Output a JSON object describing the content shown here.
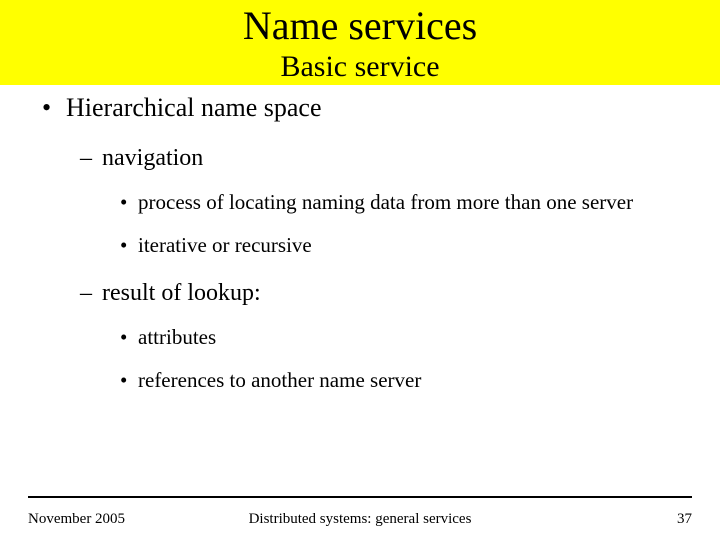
{
  "header": {
    "title": "Name services",
    "subtitle": "Basic service"
  },
  "bullets": {
    "l1": "Hierarchical name space",
    "l2a": "navigation",
    "l3a": "process of locating naming data from more than one server",
    "l3b": "iterative or recursive",
    "l2b": "result of lookup:",
    "l3c": "attributes",
    "l3d": "references to another name server"
  },
  "footer": {
    "date": "November 2005",
    "center": "Distributed systems: general services",
    "page": "37"
  }
}
